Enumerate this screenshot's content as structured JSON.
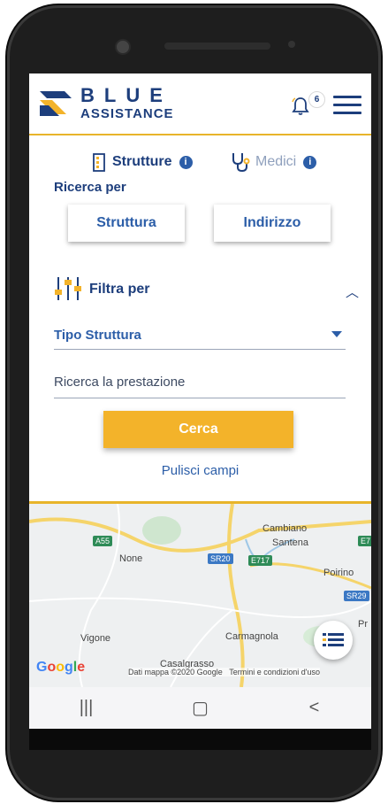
{
  "header": {
    "brand_top": "BLUE",
    "brand_sub": "ASSISTANCE",
    "notification_count": "6"
  },
  "tabs": [
    {
      "label": "Strutture",
      "active": true
    },
    {
      "label": "Medici",
      "active": false
    }
  ],
  "search": {
    "ricerca_label": "Ricerca per",
    "option_struttura": "Struttura",
    "option_indirizzo": "Indirizzo",
    "filter_label": "Filtra per",
    "tipo_struttura": "Tipo Struttura",
    "prestazione_placeholder": "Ricerca la prestazione",
    "cerca_label": "Cerca",
    "pulisci_label": "Pulisci campi"
  },
  "map": {
    "places": [
      "Cambiano",
      "Santena",
      "None",
      "Poirino",
      "Vigone",
      "Carmagnola",
      "Casalgrasso",
      "Pr"
    ],
    "roads": [
      "A55",
      "SR20",
      "E717",
      "SR29",
      "E7"
    ],
    "attribution": "Dati mappa ©2020 Google",
    "terms": "Termini e condizioni d'uso",
    "google": "Google"
  },
  "colors": {
    "primary": "#1d3e7c",
    "accent": "#f3b32a",
    "link": "#2c5ea8"
  },
  "navbar": [
    "|||",
    "▢",
    "<"
  ]
}
